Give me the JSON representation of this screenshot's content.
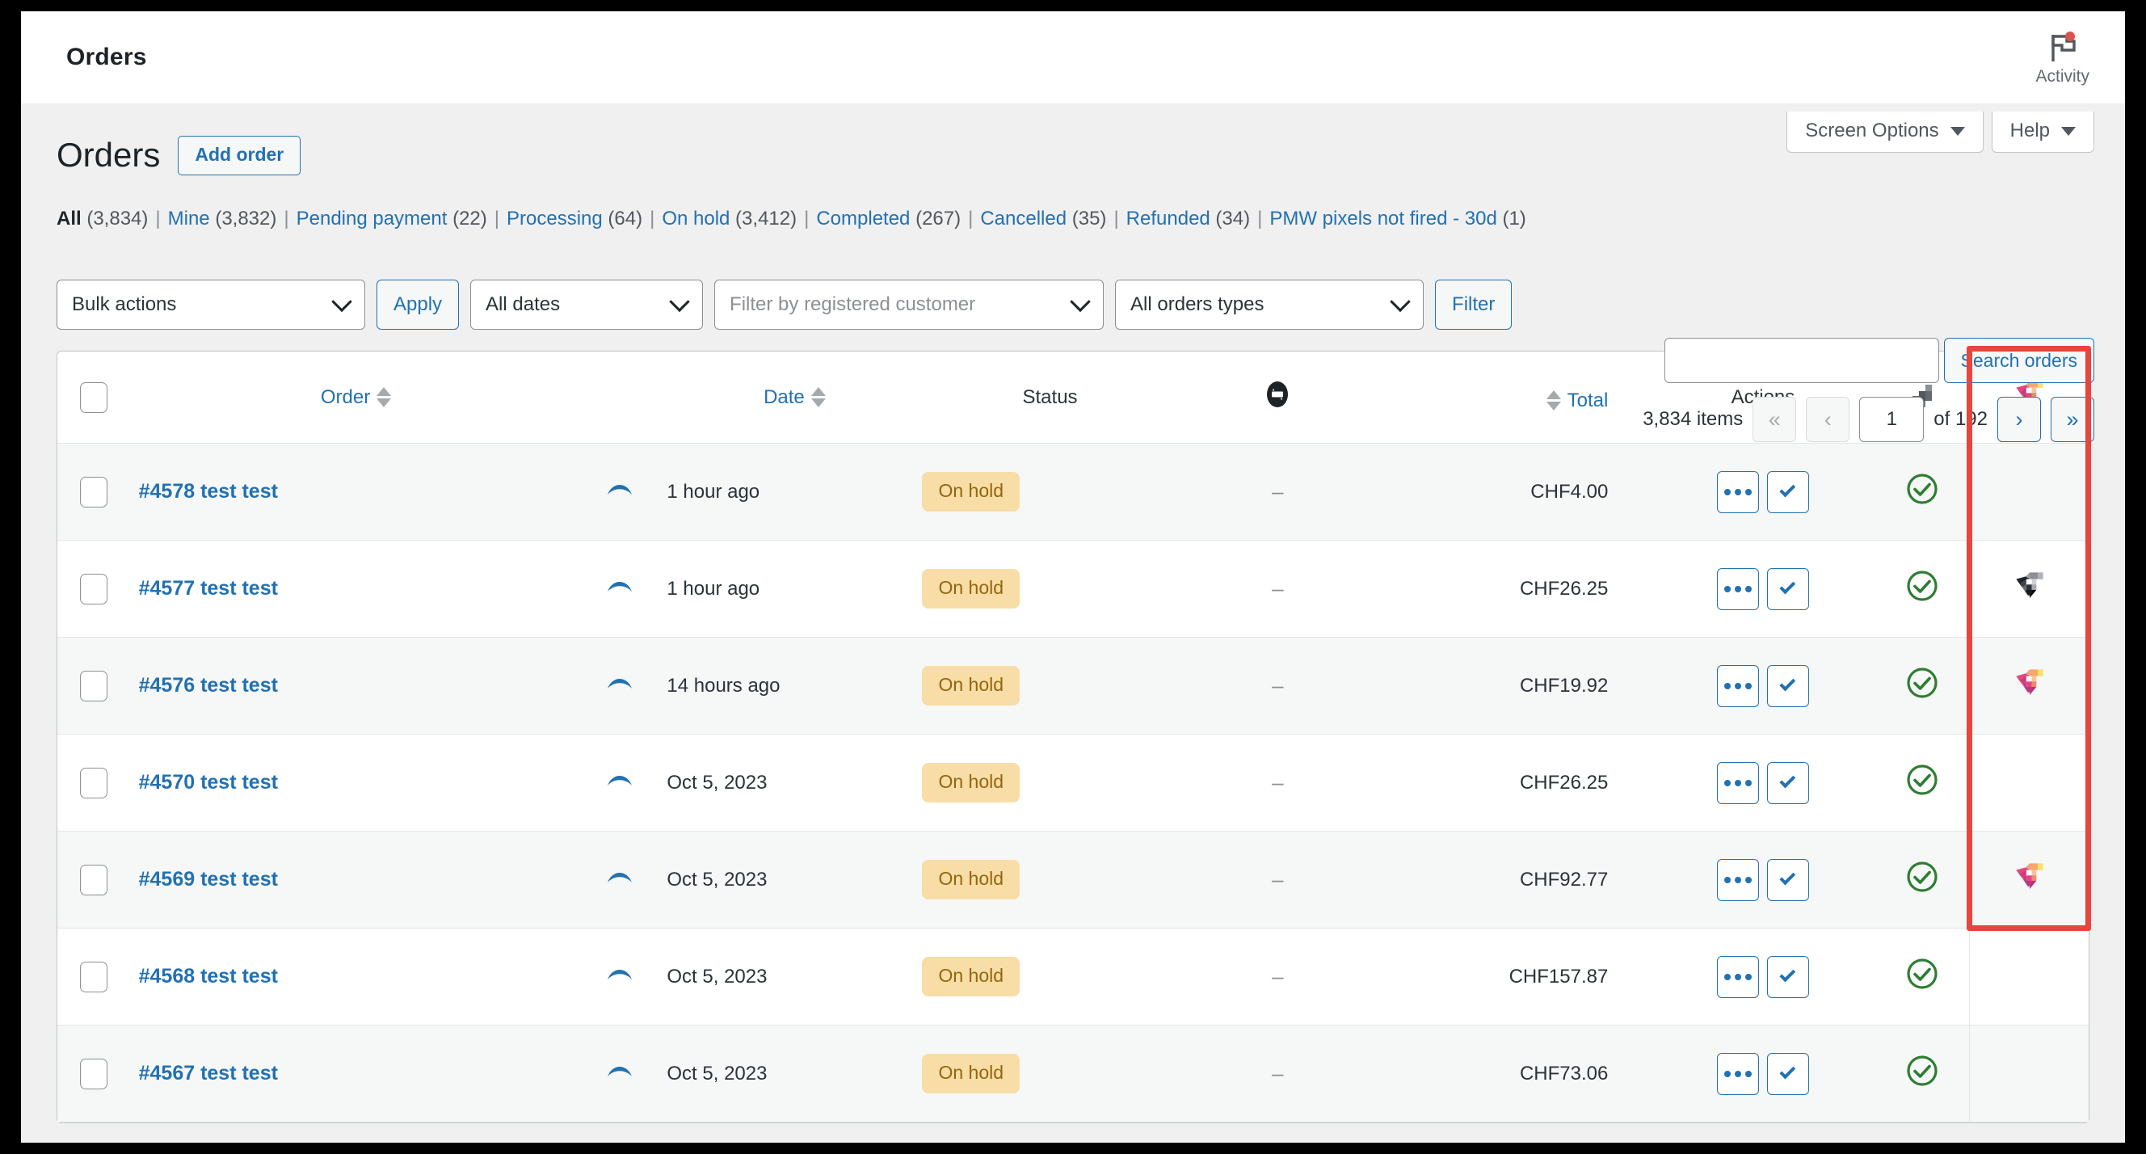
{
  "adminbar": {
    "title": "Orders",
    "activity_label": "Activity",
    "activity_icon": "flag-icon",
    "notification_dot_color": "#d9534f"
  },
  "screen_meta": {
    "screen_options_label": "Screen Options",
    "help_label": "Help",
    "caret_icon": "caret-down-icon"
  },
  "page": {
    "title": "Orders",
    "add_order_label": "Add order"
  },
  "status_filters": [
    {
      "label": "All",
      "count": "(3,834)",
      "current": true
    },
    {
      "label": "Mine",
      "count": "(3,832)",
      "current": false
    },
    {
      "label": "Pending payment",
      "count": "(22)",
      "current": false
    },
    {
      "label": "Processing",
      "count": "(64)",
      "current": false
    },
    {
      "label": "On hold",
      "count": "(3,412)",
      "current": false
    },
    {
      "label": "Completed",
      "count": "(267)",
      "current": false
    },
    {
      "label": "Cancelled",
      "count": "(35)",
      "current": false
    },
    {
      "label": "Refunded",
      "count": "(34)",
      "current": false
    },
    {
      "label": "PMW pixels not fired - 30d",
      "count": "(1)",
      "current": false
    }
  ],
  "search": {
    "value": "",
    "placeholder": "",
    "submit_label": "Search orders"
  },
  "toolbar": {
    "bulk_actions_value": "Bulk actions",
    "apply_label": "Apply",
    "dates_value": "All dates",
    "customer_placeholder": "Filter by registered customer",
    "order_types_value": "All orders types",
    "filter_label": "Filter"
  },
  "pagination": {
    "items_text": "3,834 items",
    "first_icon": "«",
    "prev_icon": "‹",
    "current_page": "1",
    "of_text": "of 192",
    "next_icon": "›",
    "last_icon": "»"
  },
  "table": {
    "headers": {
      "select_all": "select-all-checkbox",
      "order": "Order",
      "preview": "preview-icon",
      "date": "Date",
      "status": "Status",
      "note": "order-note-icon",
      "total": "Total",
      "actions": "Actions",
      "pys": "pixelyoursite-bars-icon",
      "pmw": "pmw-gem-icon"
    },
    "rows": [
      {
        "order": "#4578 test test",
        "date": "1 hour ago",
        "status": "On hold",
        "note": "–",
        "total": "CHF4.00",
        "fired": true,
        "gem": "none"
      },
      {
        "order": "#4577 test test",
        "date": "1 hour ago",
        "status": "On hold",
        "note": "–",
        "total": "CHF26.25",
        "fired": true,
        "gem": "gray"
      },
      {
        "order": "#4576 test test",
        "date": "14 hours ago",
        "status": "On hold",
        "note": "–",
        "total": "CHF19.92",
        "fired": true,
        "gem": "color"
      },
      {
        "order": "#4570 test test",
        "date": "Oct 5, 2023",
        "status": "On hold",
        "note": "–",
        "total": "CHF26.25",
        "fired": true,
        "gem": "none"
      },
      {
        "order": "#4569 test test",
        "date": "Oct 5, 2023",
        "status": "On hold",
        "note": "–",
        "total": "CHF92.77",
        "fired": true,
        "gem": "color"
      },
      {
        "order": "#4568 test test",
        "date": "Oct 5, 2023",
        "status": "On hold",
        "note": "–",
        "total": "CHF157.87",
        "fired": true,
        "gem": "none"
      },
      {
        "order": "#4567 test test",
        "date": "Oct 5, 2023",
        "status": "On hold",
        "note": "–",
        "total": "CHF73.06",
        "fired": true,
        "gem": "none"
      }
    ]
  },
  "annotation": {
    "type": "highlight-rectangle",
    "color": "#e8453c",
    "target": "pmw-status-column"
  },
  "colors": {
    "link": "#2271b1",
    "status_bg": "#f8dda7",
    "status_fg": "#94660c",
    "success": "#2e7d32",
    "page_bg": "#f0f0f1"
  }
}
